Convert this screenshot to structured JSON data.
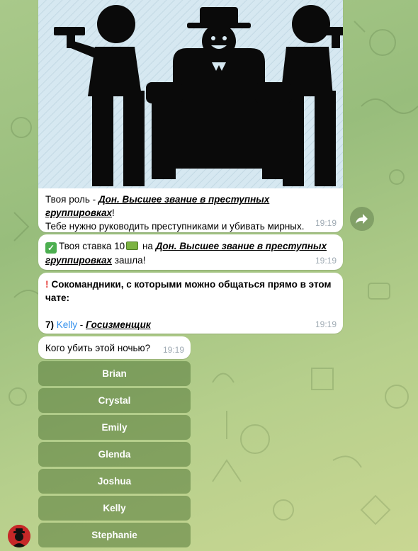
{
  "messages": {
    "role": {
      "prefix": "Твоя роль - ",
      "role_name": "Дон. Высшее звание в преступных группировках",
      "suffix": "!",
      "line2": "Тебе нужно руководить преступниками и убивать мирных.",
      "time": "19:19"
    },
    "bet": {
      "prefix": "Твоя ставка 10",
      "middle": " на ",
      "role_name_1": "Дон. Высшее звание в преступных",
      "role_name_2": "группировках",
      "suffix": " зашла!",
      "time": "19:19"
    },
    "teammates": {
      "line1": "Сокомандники, с которыми можно общаться прямо в этом",
      "line2": "чате:",
      "number": "7) ",
      "name": "Kelly",
      "dash": " - ",
      "role": "Госизменщик",
      "time": "19:19"
    },
    "question": {
      "text": "Кого убить этой ночью?",
      "time": "19:19"
    }
  },
  "keyboard": {
    "buttons": [
      "Brian",
      "Crystal",
      "Emily",
      "Glenda",
      "Joshua",
      "Kelly",
      "Stephanie"
    ]
  },
  "icons": {
    "forward": "forward-arrow-icon",
    "avatar": "mafia-avatar-icon",
    "check": "check-mark-icon",
    "money": "money-icon",
    "exclamation": "exclamation-icon"
  },
  "colors": {
    "link": "#3390ec",
    "button_bg": "#567a3a",
    "time": "#a0abb4",
    "check": "#4caf50",
    "exclamation": "#e53935"
  }
}
